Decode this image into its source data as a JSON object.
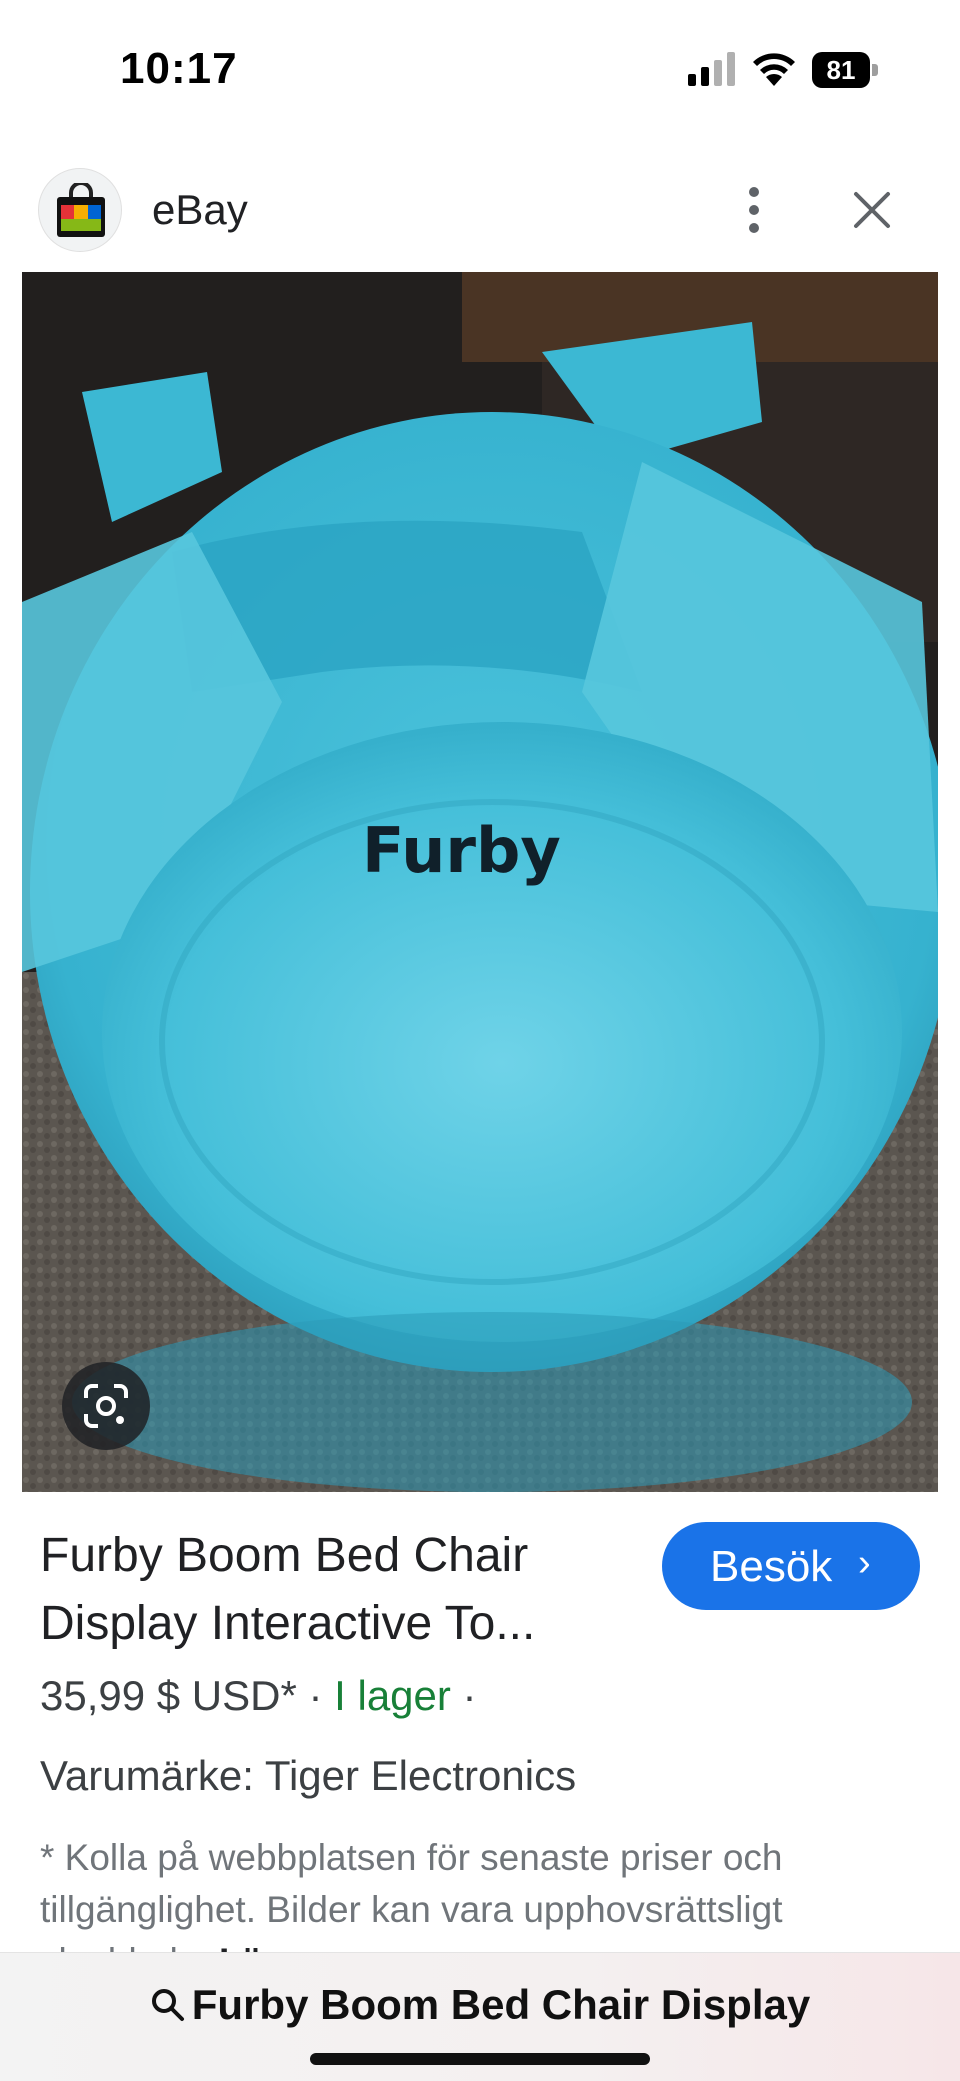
{
  "status_bar": {
    "time": "10:17",
    "battery": "81"
  },
  "header": {
    "site_name": "eBay",
    "logo_icon": "shopping-bag-icon",
    "menu_icon": "more-vertical-icon",
    "close_icon": "close-icon"
  },
  "image": {
    "lens_icon": "google-lens-icon",
    "logo_text": "Furby"
  },
  "product": {
    "title": "Furby Boom Bed Chair Display Interactive To...",
    "visit_label": "Besök",
    "visit_chevron": "›",
    "price": "35,99 $ USD*",
    "separator": " · ",
    "stock": "I lager",
    "trailing_separator": " ·",
    "brand": "Varumärke: Tiger Electronics",
    "disclaimer": "* Kolla på webbplatsen för senaste priser och tillgänglighet. Bilder kan vara upphovsrättsligt skyddade.",
    "read_more": "Läs mer"
  },
  "search": {
    "query": "Furby Boom Bed Chair Display"
  },
  "colors": {
    "accent": "#1a73e8",
    "stock_green": "#188038",
    "plush_blue": "#3ab9d6"
  }
}
